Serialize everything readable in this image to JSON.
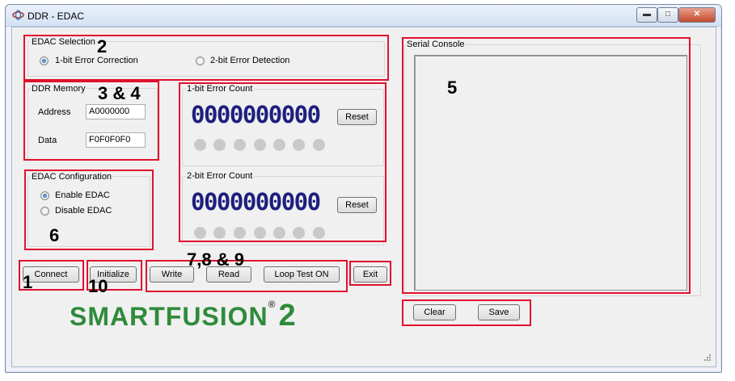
{
  "window": {
    "title": "DDR - EDAC",
    "minimize_glyph": "▬",
    "maximize_glyph": "□",
    "close_glyph": "✕",
    "icon": "app-icon"
  },
  "edac_selection": {
    "label": "EDAC Selection",
    "options": [
      {
        "label": "1-bit Error Correction",
        "selected": true
      },
      {
        "label": "2-bit Error Detection",
        "selected": false
      }
    ]
  },
  "ddr_memory": {
    "label": "DDR Memory",
    "address_label": "Address",
    "address_value": "A0000000",
    "data_label": "Data",
    "data_value": "F0F0F0F0"
  },
  "edac_config": {
    "label": "EDAC Configuration",
    "options": [
      {
        "label": "Enable EDAC",
        "selected": true
      },
      {
        "label": "Disable EDAC",
        "selected": false
      }
    ]
  },
  "one_bit": {
    "label": "1-bit Error Count",
    "count": "0000000000",
    "reset_label": "Reset"
  },
  "two_bit": {
    "label": "2-bit Error Count",
    "count": "0000000000",
    "reset_label": "Reset"
  },
  "serial": {
    "label": "Serial Console",
    "clear_label": "Clear",
    "save_label": "Save"
  },
  "buttons": {
    "connect": "Connect",
    "initialize": "Initialize",
    "write": "Write",
    "read": "Read",
    "loop": "Loop Test ON",
    "exit": "Exit"
  },
  "logo": {
    "text": "SMARTFUSION",
    "reg": "®",
    "num": "2"
  },
  "annotations": {
    "a1": "1",
    "a2": "2",
    "a34": "3 & 4",
    "a5": "5",
    "a6": "6",
    "a789": "7,8 & 9",
    "a10": "10"
  },
  "colors": {
    "annotation_box": "#e0112d",
    "lcd_digits": "#1f1f7e",
    "logo_green": "#2e8b3a",
    "logo_blue": "#1d3f7a"
  }
}
